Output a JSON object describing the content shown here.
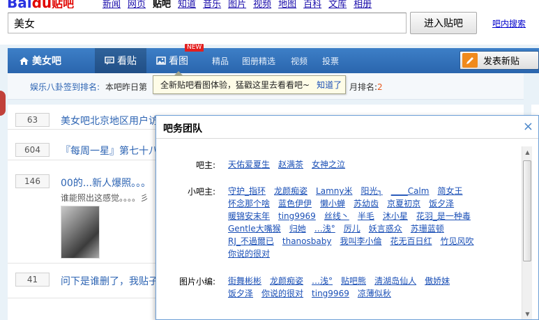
{
  "topbar": {
    "logo_text": "Bai",
    "logo_paw": "du",
    "logo_product": "贴吧",
    "nav": [
      "新闻",
      "网页",
      "贴吧",
      "知道",
      "音乐",
      "图片",
      "视频",
      "地图",
      "百科",
      "文库",
      "相册"
    ],
    "active_nav": "贴吧"
  },
  "search": {
    "value": "美女",
    "enter_label": "进入贴吧",
    "in_bar_search": "吧内搜索"
  },
  "navbar": {
    "home": "美女吧",
    "tab_posts": "看贴",
    "tab_pics": "看图",
    "new_badge": "NEW",
    "links": [
      "精品",
      "图册精选",
      "视频",
      "投票"
    ],
    "post_button": "发表新贴"
  },
  "signrow": {
    "left": "娱乐八卦签到排名:",
    "sub": "本吧昨日第",
    "right_prefix": "月排名:",
    "right_num": "2"
  },
  "tooltip": {
    "text": "全新贴吧看图体验，猛戳这里去看看吧~",
    "ok": "知道了"
  },
  "threads": [
    {
      "count": "63",
      "title": "美女吧北京地区用户访"
    },
    {
      "count": "604",
      "title": "『每周一星』第七十八"
    },
    {
      "count": "146",
      "title": "00的...新人爆照。。。",
      "excerpt": "谁能照出这感觉。。。。彡"
    },
    {
      "count": "41",
      "title": "问下是谁删了，我贴子"
    }
  ],
  "modal": {
    "title": "吧务团队",
    "close": "×",
    "sections": [
      {
        "label": "吧主:",
        "names": [
          "天佑爱夏生",
          "赵满茶",
          "女神之泣"
        ]
      },
      {
        "label": "小吧主:",
        "names": [
          "守护_指环",
          "龙颜痴姿",
          "Lamny米",
          "阳光┐",
          "____Calm",
          "简女王",
          "怀念那个啥",
          "蓝色伊伊",
          "懒小蝉",
          "苏幼齿",
          "京夏初京",
          "饭夕泽",
          "暖锦安末年",
          "ting9969",
          "丝线丶",
          "半毛",
          "沐小星",
          "花羽_是一种毒",
          "Gentle大嘴猴",
          "归她",
          "…浅°",
          "厉儿",
          "妖言惑众",
          "苏珊蓝顿",
          "RJ_不過爾已",
          "thanosbaby",
          "我叫李小倫",
          "花无百日红",
          "竹见风吹",
          "你说的很对"
        ]
      },
      {
        "label": "图片小编:",
        "names": [
          "街舞彬彬",
          "龙颜痴姿",
          "…浅°",
          "贴吧熊",
          "清湖岛仙人",
          "傲娇妹",
          "饭夕泽",
          "你说的很对",
          "ting9969",
          "凉薄似秋"
        ]
      }
    ]
  }
}
